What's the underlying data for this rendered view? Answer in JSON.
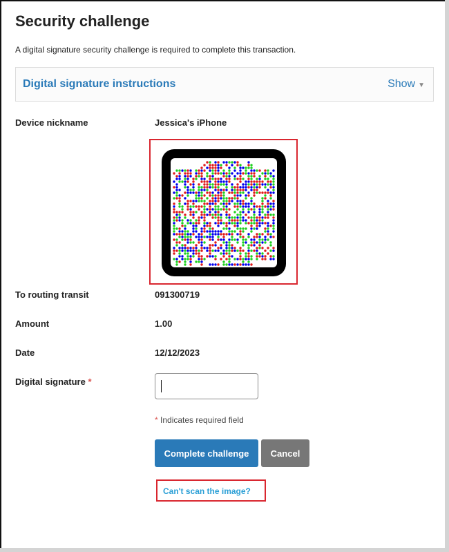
{
  "page": {
    "title": "Security challenge",
    "subtitle": "A digital signature security challenge is required to complete this transaction."
  },
  "instructions_panel": {
    "title": "Digital signature instructions",
    "toggle_label": "Show"
  },
  "fields": {
    "device_label": "Device nickname",
    "device_value": "Jessica's iPhone",
    "routing_label": "To routing transit",
    "routing_value": "091300719",
    "amount_label": "Amount",
    "amount_value": "1.00",
    "date_label": "Date",
    "date_value": "12/12/2023",
    "signature_label": "Digital signature",
    "required_marker": "*",
    "signature_value": "",
    "required_note": "Indicates required field"
  },
  "buttons": {
    "complete_label": "Complete challenge",
    "cancel_label": "Cancel"
  },
  "help_link": {
    "label": "Can't scan the image?"
  },
  "colors": {
    "accent": "#2a7ab8",
    "link": "#2a9fd6",
    "highlight_box": "#d9262f",
    "required": "#d9534f",
    "code_dots": [
      "#0000ee",
      "#e01b1b",
      "#1fd11f"
    ]
  }
}
